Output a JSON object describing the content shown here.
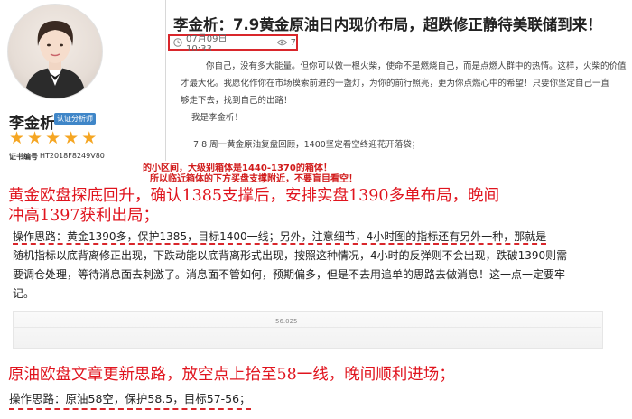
{
  "author": {
    "name": "李金析",
    "badge": "认证分析师",
    "rating_stars": 5,
    "cert_label": "证书编号",
    "cert_number": "HT2018F8249V80"
  },
  "article": {
    "title": "李金析：7.9黄金原油日内现价布局，超跌修正静待美联储到来！",
    "date": "07月09日 10:33",
    "views": "7",
    "intro_lines": [
      "你自己，没有多大能量。但你可以做一根火柴，使命不是燃烧自己，而是点燃人群中的热情。这样，火柴的价值",
      "才最大化。我愿化作你在市场摸索前进的一盏灯，为你的前行照亮，更为你点燃心中的希望！只要你坚定自己一直",
      "够走下去，找到自己的出路！"
    ],
    "signature": "我是李金析！",
    "review": "7.8 周一黄金原油复盘回顾，1400坚定看空终迎花开落袋；"
  },
  "red_note": {
    "line1": "的小区间，大级别箱体是1440-1370的箱体！",
    "line2": "所以临近箱体的下方买盘支撑附近，不要盲目看空！"
  },
  "gold_summary": {
    "line1": "黄金欧盘探底回升，确认1385支撑后，安排实盘1390多单布局，晚间",
    "line2": "冲高1397获利出局；"
  },
  "gold_plan": {
    "line1": "操作思路：黄金1390多，保护1385，目标1400一线；另外，注意细节，4小时图的指标还有另外一种，那就是",
    "line2": "随机指标以底背离修正出现，下跌动能以底背离形式出现，按照这种情况，4小时的反弹则不会出现，跌破1390则需",
    "line3": "要调仓处理，等待消息面去刺激了。消息面不管如何，预期偏多，但是不去用追单的思路去做消息！这一点一定要牢",
    "line4": "记。"
  },
  "chart_snippet": {
    "value_label": "56.025"
  },
  "oil_summary": "原油欧盘文章更新思路，放空点上抬至58一线，晚间顺利进场；",
  "oil_plan": "操作思路：原油58空，保护58.5，目标57-56；",
  "colors": {
    "accent_red": "#e0141e",
    "star": "#f5a623",
    "badge_blue": "#3f86c8"
  },
  "icons": {
    "date": "clock-icon",
    "views": "eye-icon",
    "rating": "star-icon"
  }
}
